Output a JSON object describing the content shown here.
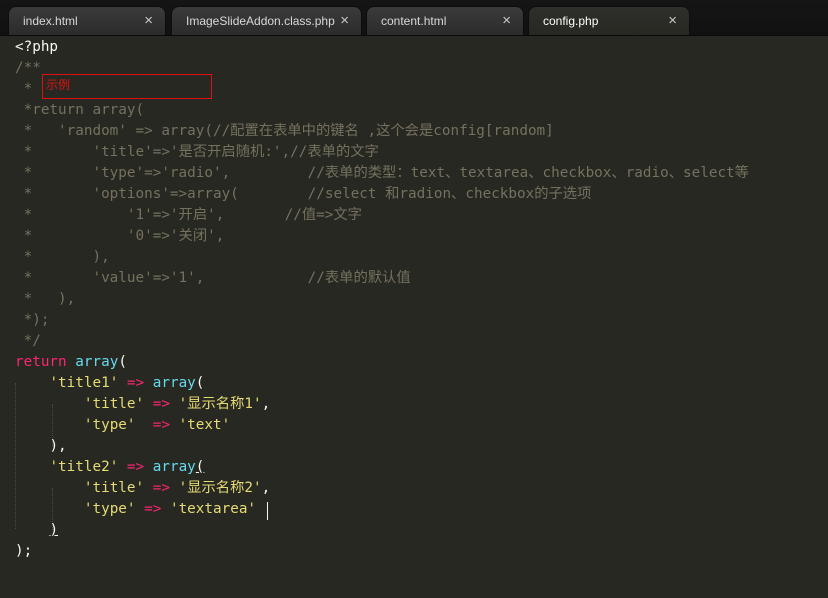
{
  "tabs": [
    {
      "label": "index.html",
      "close": "×"
    },
    {
      "label": "ImageSlideAddon.class.php",
      "close": "×"
    },
    {
      "label": "content.html",
      "close": "×"
    },
    {
      "label": "config.php",
      "close": "×"
    }
  ],
  "annotation": {
    "text": "示例"
  },
  "code": {
    "l1": "<?php",
    "l2": "/**",
    "l3": " *",
    "l4": " *return array(",
    "l5": " *   'random' => array(//配置在表单中的键名 ,这个会是config[random]",
    "l6": " *       'title'=>'是否开启随机:',//表单的文字",
    "l7": " *       'type'=>'radio',         //表单的类型：text、textarea、checkbox、radio、select等",
    "l8": " *       'options'=>array(        //select 和radion、checkbox的子选项",
    "l9": " *           '1'=>'开启',       //值=>文字",
    "l10": " *           '0'=>'关闭',",
    "l11": " *       ),",
    "l12": " *       'value'=>'1',            //表单的默认值",
    "l13": " *   ),",
    "l14": " *);",
    "l15": " */",
    "l16_kw": "return",
    "l16_fn": "array",
    "l16_p": "(",
    "l17_s": "'title1'",
    "l17_o": "=>",
    "l17_f": "array",
    "l17_p": "(",
    "l18_s1": "'title'",
    "l18_o": "=>",
    "l18_s2": "'显示名称1'",
    "l18_p": ",",
    "l19_s1": "'type'",
    "l19_o": "=>",
    "l19_s2": "'text'",
    "l20": "),",
    "l21_s": "'title2'",
    "l21_o": "=>",
    "l21_f": "array",
    "l21_p": "(",
    "l22_s1": "'title'",
    "l22_o": "=>",
    "l22_s2": "'显示名称2'",
    "l22_p": ",",
    "l23_s1": "'type'",
    "l23_o": "=>",
    "l23_s2": "'textarea'",
    "l24": ")",
    "l25": ");"
  },
  "colors": {
    "background": "#272822",
    "comment": "#75715e",
    "keyword": "#f92672",
    "function": "#66d9ef",
    "string": "#e6db74",
    "annotation": "#e01010"
  }
}
